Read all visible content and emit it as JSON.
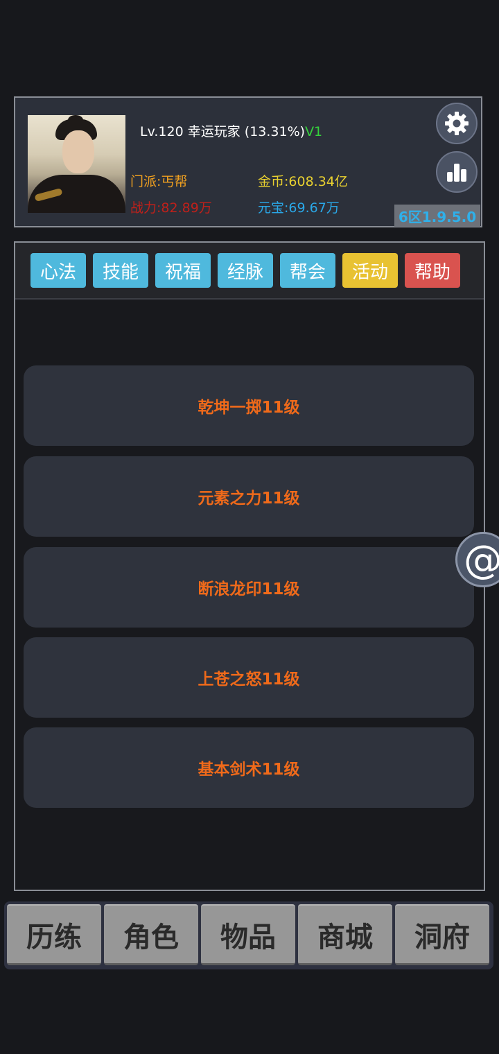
{
  "player": {
    "level": "Lv.120",
    "name": "幸运玩家",
    "exp_percent": "(13.31%)",
    "vip": "V1",
    "sect": "门派:丐帮",
    "power": "战力:82.89万",
    "gold": "金币:608.34亿",
    "ingot": "元宝:69.67万",
    "server": "6区1.9.5.0"
  },
  "header_icons": [
    "gear-icon",
    "bar-chart-icon"
  ],
  "tabs": [
    {
      "label": "心法",
      "color": "#4fb9dd"
    },
    {
      "label": "技能",
      "color": "#4fb9dd"
    },
    {
      "label": "祝福",
      "color": "#4fb9dd"
    },
    {
      "label": "经脉",
      "color": "#4fb9dd"
    },
    {
      "label": "帮会",
      "color": "#4fb9dd"
    },
    {
      "label": "活动",
      "color": "#e8c232"
    },
    {
      "label": "帮助",
      "color": "#d9534f"
    }
  ],
  "skills": [
    {
      "label": "乾坤一掷11级"
    },
    {
      "label": "元素之力11级"
    },
    {
      "label": "断浪龙印11级"
    },
    {
      "label": "上苍之怒11级"
    },
    {
      "label": "基本剑术11级"
    }
  ],
  "float_button": {
    "glyph": "@"
  },
  "bottom_nav": [
    {
      "label": "历练"
    },
    {
      "label": "角色"
    },
    {
      "label": "物品"
    },
    {
      "label": "商城"
    },
    {
      "label": "洞府"
    }
  ],
  "colors": {
    "sect": "#f0a020",
    "power": "#c0201a",
    "gold": "#e8d030",
    "ingot": "#2aa8e8",
    "skill_text": "#f06a1a",
    "vip": "#35d23c"
  }
}
